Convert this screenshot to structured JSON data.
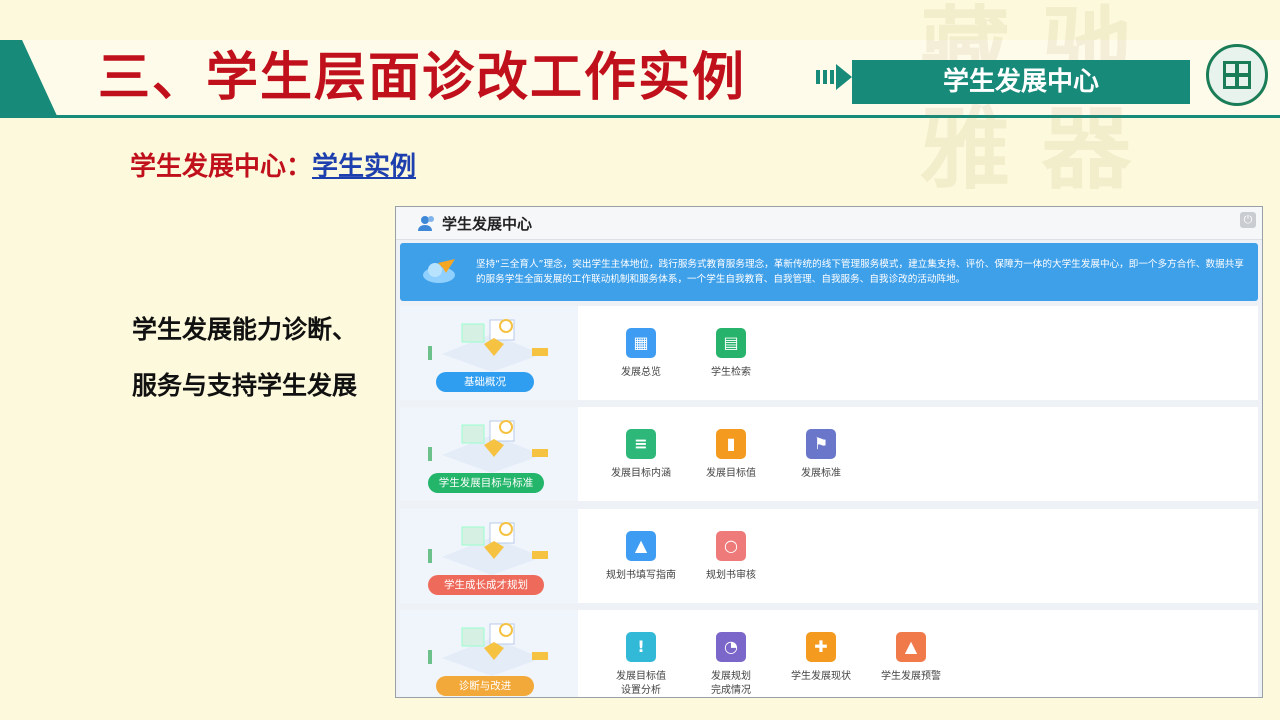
{
  "header": {
    "title": "三、学生层面诊改工作实例",
    "badge": "学生发展中心"
  },
  "subtitle": {
    "prefix": "学生发展中心：",
    "link": "学生实例"
  },
  "side_text": {
    "line1": "学生发展能力诊断、",
    "line2": "服务与支持学生发展"
  },
  "window": {
    "title": "学生发展中心",
    "banner_text": "坚持“三全育人”理念，突出学生主体地位，践行服务式教育服务理念，革新传统的线下管理服务模式，建立集支持、评价、保障为一体的大学生发展中心，即一个多方合作、数据共享的服务学生全面发展的工作联动机制和服务体系，一个学生自我教育、自我管理、自我服务、自我诊改的活动阵地。",
    "sections": [
      {
        "pill": "基础概况",
        "pill_color": "#2f9df0",
        "items": [
          {
            "label": "发展总览",
            "color": "#3e9df2",
            "icon": "grid-icon"
          },
          {
            "label": "学生检索",
            "color": "#27b36b",
            "icon": "id-card-icon"
          }
        ]
      },
      {
        "pill": "学生发展目标与标准",
        "pill_color": "#23b56a",
        "items": [
          {
            "label": "发展目标内涵",
            "color": "#2db87a",
            "icon": "document-icon"
          },
          {
            "label": "发展目标值",
            "color": "#f39a1f",
            "icon": "bar-chart-icon"
          },
          {
            "label": "发展标准",
            "color": "#6a76c9",
            "icon": "flag-icon"
          }
        ]
      },
      {
        "pill": "学生成长成才规划",
        "pill_color": "#ee6b5c",
        "items": [
          {
            "label": "规划书填写指南",
            "color": "#3e9df2",
            "icon": "graduation-cap-icon"
          },
          {
            "label": "规划书审核",
            "color": "#ee7a7a",
            "icon": "search-icon"
          }
        ]
      },
      {
        "pill": "诊断与改进",
        "pill_color": "#f2a93a",
        "items": [
          {
            "label": "发展目标值\n设置分析",
            "color": "#33b9d8",
            "icon": "alert-icon"
          },
          {
            "label": "发展规划\n完成情况",
            "color": "#7a67c9",
            "icon": "pie-chart-icon"
          },
          {
            "label": "学生发展现状",
            "color": "#f39a1f",
            "icon": "puzzle-icon"
          },
          {
            "label": "学生发展预警",
            "color": "#f07a4a",
            "icon": "bell-icon"
          }
        ]
      }
    ]
  }
}
